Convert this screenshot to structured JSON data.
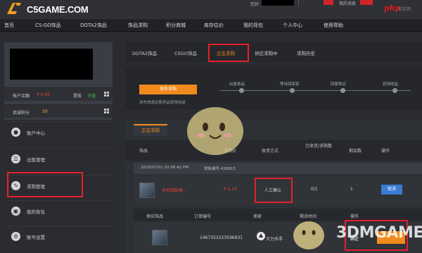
{
  "header": {
    "brand": "C5GAME.COM",
    "login_hint": "您好",
    "message_link": "我的消息",
    "php_badge": "php",
    "php_sub": "中文网"
  },
  "nav": {
    "items": [
      "首页",
      "CS:GO饰品",
      "DOTA2饰品",
      "饰品求购",
      "积分商城",
      "库存估价",
      "我的背包",
      "个人中心",
      "使用帮助"
    ]
  },
  "sidebar": {
    "balance_label": "账户余额",
    "balance_value": "¥ 0.09",
    "recharge": "提现",
    "withdraw": "充值",
    "points_label": "商城积分",
    "points_value": "20",
    "menu": [
      {
        "label": "账户中心",
        "icon": "user-icon"
      },
      {
        "label": "出售管理",
        "icon": "list-icon"
      },
      {
        "label": "求购管理",
        "icon": "brush-icon"
      },
      {
        "label": "我的背包",
        "icon": "bag-icon"
      },
      {
        "label": "账号设置",
        "icon": "gear-icon"
      }
    ]
  },
  "main": {
    "tabs": [
      "DOTA2饰品",
      "CSGO饰品",
      "正在求购",
      "供应求购中",
      "求购历史"
    ],
    "publish_button": "发布求购",
    "publish_hint": "发布快速出售饰品获得收益",
    "steps": [
      "出售饰品",
      "等待回卖家",
      "回家购买",
      "获得收益"
    ],
    "panel_tab": "正在求购",
    "columns": [
      "饰品",
      "求购价",
      "收货方式",
      "已收货/求购数",
      "剩余数",
      "操作"
    ],
    "order": {
      "date": "2016/07/01 02:06:42 PM",
      "order_no": "销售编号:438815"
    },
    "item": {
      "name": "冰冠骑装备...",
      "price": "¥ 1.15",
      "delivery": "人工确认",
      "progress": "0/1",
      "remaining": "1",
      "action": "取消"
    },
    "sub_columns": [
      "供应饰品",
      "订单编号",
      "卖家",
      "剩余时间",
      "操作"
    ],
    "sub_row": {
      "order_number": "1467353223596931",
      "seller": "大力水手",
      "action": "确定"
    }
  },
  "watermark": {
    "text": "3DMGAME",
    "tag": "3DMGAME"
  },
  "colors": {
    "accent": "#f08a1c",
    "highlight_box": "#e52128",
    "price_red": "#e8442e",
    "button_blue": "#3a7bd5"
  }
}
